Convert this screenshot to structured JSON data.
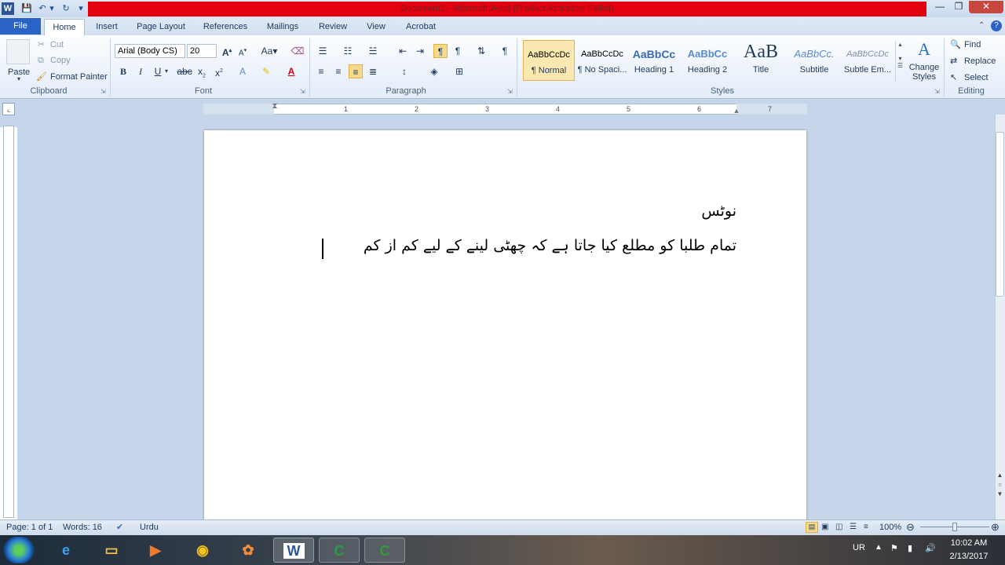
{
  "window": {
    "title": "Document2 - Microsoft Word (Product Activation Failed)"
  },
  "tabs": [
    "File",
    "Home",
    "Insert",
    "Page Layout",
    "References",
    "Mailings",
    "Review",
    "View",
    "Acrobat"
  ],
  "clipboard": {
    "paste": "Paste",
    "cut": "Cut",
    "copy": "Copy",
    "format_painter": "Format Painter",
    "label": "Clipboard"
  },
  "font": {
    "name": "Arial (Body CS)",
    "size": "20",
    "label": "Font"
  },
  "paragraph": {
    "label": "Paragraph"
  },
  "styles": {
    "label": "Styles",
    "items": [
      {
        "preview": "AaBbCcDc",
        "name": "¶ Normal"
      },
      {
        "preview": "AaBbCcDc",
        "name": "¶ No Spaci..."
      },
      {
        "preview": "AaBbCc",
        "name": "Heading 1"
      },
      {
        "preview": "AaBbCc",
        "name": "Heading 2"
      },
      {
        "preview": "AaB",
        "name": "Title"
      },
      {
        "preview": "AaBbCc.",
        "name": "Subtitle"
      },
      {
        "preview": "AaBbCcDc",
        "name": "Subtle Em..."
      }
    ],
    "change": "Change Styles"
  },
  "editing": {
    "find": "Find",
    "replace": "Replace",
    "select": "Select",
    "label": "Editing"
  },
  "ruler": {
    "numbers": [
      "1",
      "2",
      "3",
      "4",
      "5",
      "6",
      "7"
    ]
  },
  "document": {
    "heading": "نوٹس",
    "body": "تمام طلبا کو مطلع کیا جاتا ہے کہ چھٹی لینے کے لیے کم از کم"
  },
  "status": {
    "page": "Page: 1 of 1",
    "words": "Words: 16",
    "language": "Urdu",
    "zoom": "100%"
  },
  "taskbar": {
    "lang": "UR",
    "time": "10:02 AM",
    "date": "2/13/2017"
  }
}
